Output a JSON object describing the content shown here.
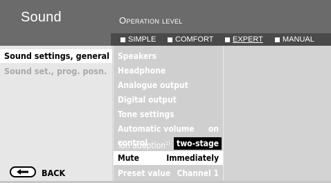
{
  "header": {
    "title": "Sound",
    "operation_level": "Operation level",
    "levels": [
      {
        "label": "SIMPLE",
        "selected": false
      },
      {
        "label": "COMFORT",
        "selected": false
      },
      {
        "label": "EXPERT",
        "selected": true
      },
      {
        "label": "MANUAL",
        "selected": false
      }
    ]
  },
  "left_menu": {
    "items": [
      {
        "label": "Sound settings, general",
        "active": true
      },
      {
        "label": "Sound set., prog. posn.",
        "active": false
      }
    ],
    "back_label": "BACK"
  },
  "settings": {
    "rows": [
      {
        "label": "Speakers"
      },
      {
        "label": "Headphone"
      },
      {
        "label": "Analogue output"
      },
      {
        "label": "Digital output"
      },
      {
        "label": "Tone settings"
      },
      {
        "label": "Automatic volume control",
        "value": "on"
      },
      {
        "label": "Ton adaption",
        "footnote": "1)",
        "value": "two-stage"
      },
      {
        "label": "Mute",
        "value": "Immediately"
      },
      {
        "label": "Preset value",
        "value": "Channel 1"
      }
    ]
  },
  "colors": {
    "header_bg": "#6b6b6b",
    "level_bar_bg": "#4a4a4a",
    "panel_bg": "#d3d3d3",
    "left_bg": "#e7e7e7",
    "highlight": "#ffffff",
    "value_highlight_bg": "#000000"
  }
}
